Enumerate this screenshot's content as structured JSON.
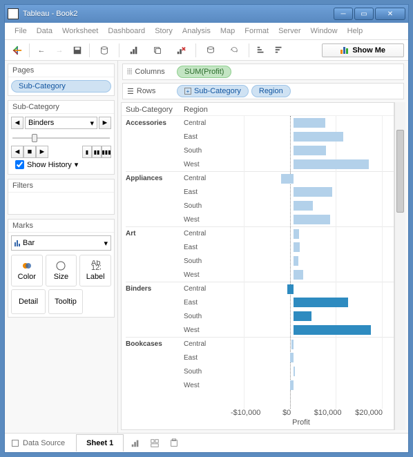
{
  "window": {
    "title": "Tableau - Book2"
  },
  "menu": [
    "File",
    "Data",
    "Worksheet",
    "Dashboard",
    "Story",
    "Analysis",
    "Map",
    "Format",
    "Server",
    "Window",
    "Help"
  ],
  "toolbar": {
    "showme": "Show Me"
  },
  "sidebar": {
    "pages": {
      "title": "Pages",
      "pill": "Sub-Category"
    },
    "subcat": {
      "title": "Sub-Category",
      "value": "Binders",
      "history": "Show History"
    },
    "filters": {
      "title": "Filters"
    },
    "marks": {
      "title": "Marks",
      "type": "Bar",
      "cards": [
        "Color",
        "Size",
        "Label"
      ],
      "cards2": [
        "Detail",
        "Tooltip"
      ]
    }
  },
  "shelves": {
    "columns": {
      "label": "Columns",
      "pills": [
        {
          "text": "SUM(Profit)",
          "cls": "green"
        }
      ]
    },
    "rows": {
      "label": "Rows",
      "pills": [
        {
          "text": "Sub-Category",
          "cls": "blue",
          "expand": true
        },
        {
          "text": "Region",
          "cls": "blue"
        }
      ]
    }
  },
  "chart_headers": {
    "h1": "Sub-Category",
    "h2": "Region"
  },
  "axis": {
    "ticks": [
      {
        "label": "-$10,000",
        "v": -10000
      },
      {
        "label": "$0",
        "v": 0
      },
      {
        "label": "$10,000",
        "v": 10000
      },
      {
        "label": "$20,000",
        "v": 20000
      }
    ],
    "xlabel": "Profit",
    "min": -15000,
    "max": 22000
  },
  "chart_data": {
    "type": "bar",
    "xlabel": "Profit",
    "ylabel": "",
    "xlim": [
      -15000,
      22000
    ],
    "highlight": "Binders",
    "series": [
      {
        "subcat": "Accessories",
        "region": "Central",
        "value": 7000
      },
      {
        "subcat": "Accessories",
        "region": "East",
        "value": 11000
      },
      {
        "subcat": "Accessories",
        "region": "South",
        "value": 7200
      },
      {
        "subcat": "Accessories",
        "region": "West",
        "value": 16500
      },
      {
        "subcat": "Appliances",
        "region": "Central",
        "value": -2700
      },
      {
        "subcat": "Appliances",
        "region": "East",
        "value": 8500
      },
      {
        "subcat": "Appliances",
        "region": "South",
        "value": 4300
      },
      {
        "subcat": "Appliances",
        "region": "West",
        "value": 8000
      },
      {
        "subcat": "Art",
        "region": "Central",
        "value": 1200
      },
      {
        "subcat": "Art",
        "region": "East",
        "value": 1400
      },
      {
        "subcat": "Art",
        "region": "South",
        "value": 1100
      },
      {
        "subcat": "Art",
        "region": "West",
        "value": 2200
      },
      {
        "subcat": "Binders",
        "region": "Central",
        "value": -1400
      },
      {
        "subcat": "Binders",
        "region": "East",
        "value": 12000
      },
      {
        "subcat": "Binders",
        "region": "South",
        "value": 4000
      },
      {
        "subcat": "Binders",
        "region": "West",
        "value": 17000
      },
      {
        "subcat": "Bookcases",
        "region": "Central",
        "value": -400
      },
      {
        "subcat": "Bookcases",
        "region": "East",
        "value": -800
      },
      {
        "subcat": "Bookcases",
        "region": "South",
        "value": 300
      },
      {
        "subcat": "Bookcases",
        "region": "West",
        "value": -700
      }
    ]
  },
  "status": {
    "datasource": "Data Source",
    "sheet": "Sheet 1"
  }
}
